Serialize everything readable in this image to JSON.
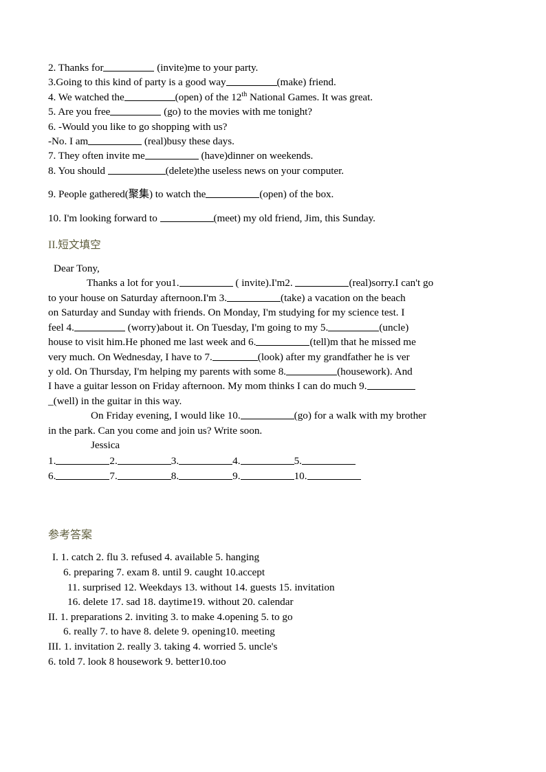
{
  "document": {
    "section_1": {
      "items": [
        {
          "id": "q2",
          "before": "2. Thanks for",
          "blank": true,
          "after": " (invite)me to your party."
        },
        {
          "id": "q3",
          "before": "3.Going to this kind of party is a good way",
          "blank": true,
          "after": "(make) friend."
        },
        {
          "id": "q4",
          "before": "4. We watched the",
          "blank": true,
          "after_pre": "(open) of the 12",
          "sup": "th",
          "after_post": " National Games. It was great."
        },
        {
          "id": "q5",
          "before": "5. Are you free",
          "blank": true,
          "after": " (go) to the movies with me tonight?"
        },
        {
          "id": "q6a",
          "before": "6. -Would you like to go shopping with us?",
          "blank": false,
          "after": ""
        },
        {
          "id": "q6b",
          "before": " -No. I am",
          "blank": true,
          "after": " (real)busy these days."
        },
        {
          "id": "q7",
          "before": "7. They often invite me",
          "blank": true,
          "after": " (have)dinner on weekends."
        },
        {
          "id": "q8",
          "before": "8. You should ",
          "blank": true,
          "after": "(delete)the useless news on your computer."
        },
        {
          "id": "q9",
          "before": "9. People gathered(聚集) to watch the",
          "blank": true,
          "after": "(open) of the box."
        },
        {
          "id": "q10",
          "before": "10. I'm looking forward to ",
          "blank": true,
          "after": "(meet) my old friend, Jim, this Sunday."
        }
      ]
    },
    "section_2": {
      "heading_roman": "II.",
      "heading_cn": "短文填空",
      "salutation": "Dear Tony,",
      "lines": [
        {
          "id": "p1",
          "segments": [
            {
              "t": "Thanks a lot for you1."
            },
            {
              "blank": "w78"
            },
            {
              "t": " ( invite).I'm2. "
            },
            {
              "blank": "w78"
            },
            {
              "t": "(real)sorry.I  can't go"
            }
          ]
        },
        {
          "id": "p2",
          "segments": [
            {
              "t": "to your house on Saturday afternoon.I'm 3."
            },
            {
              "blank": "w78"
            },
            {
              "t": "(take) a vacation on the beach"
            }
          ]
        },
        {
          "id": "p3",
          "segments": [
            {
              "t": "on Saturday and Sunday with friends. On Monday, I'm studying for my science test. I"
            }
          ]
        },
        {
          "id": "p4",
          "segments": [
            {
              "t": "feel 4."
            },
            {
              "blank": "w74"
            },
            {
              "t": " (worry)about it. On Tuesday, I'm going to my 5."
            },
            {
              "blank": "w74"
            },
            {
              "t": "(uncle)"
            }
          ]
        },
        {
          "id": "p5",
          "segments": [
            {
              "t": "house to visit him.He phoned me last week and 6."
            },
            {
              "blank": "w78"
            },
            {
              "t": "(tell)m that he missed me"
            }
          ]
        },
        {
          "id": "p6",
          "segments": [
            {
              "t": " very much. On Wednesday, I have to 7."
            },
            {
              "blank": "w66"
            },
            {
              "t": "(look) after my grandfather he is ver"
            }
          ]
        },
        {
          "id": "p7",
          "segments": [
            {
              "t": "y old. On Thursday, I'm helping my parents with some 8."
            },
            {
              "blank": "w74"
            },
            {
              "t": "(housework). And"
            }
          ]
        },
        {
          "id": "p8",
          "segments": [
            {
              "t": "I have a guitar lesson on Friday afternoon. My mom thinks I can do much 9."
            },
            {
              "blank": "w70"
            }
          ]
        },
        {
          "id": "p9",
          "segments": [
            {
              "t": "_(well) in the guitar in this way."
            }
          ]
        },
        {
          "id": "p10",
          "indent": "ind-3",
          "segments": [
            {
              "t": "On Friday evening, I would like 10."
            },
            {
              "blank": "w78"
            },
            {
              "t": "(go) for a walk with my brother"
            }
          ]
        },
        {
          "id": "p11",
          "segments": [
            {
              "t": "in the park. Can you come and join us? Write soon."
            }
          ]
        }
      ],
      "signature": "Jessica",
      "answer_rows": [
        [
          "1.",
          "2.",
          "3.",
          "4.",
          "5."
        ],
        [
          "6.",
          "7.",
          "8.",
          "9.",
          "10."
        ]
      ]
    },
    "answer_key": {
      "title": "参考答案",
      "lines": [
        {
          "id": "k1",
          "indent": "kind-1",
          "text": "I. 1. catch 2. flu 3. refused 4. available 5. hanging"
        },
        {
          "id": "k2",
          "indent": "kind-2",
          "text": "6.  preparing 7. exam 8. until 9. caught 10.accept"
        },
        {
          "id": "k3",
          "indent": "kind-3",
          "text": "11.    surprised 12. Weekdays 13. without 14. guests 15. invitation"
        },
        {
          "id": "k4",
          "indent": "kind-3",
          "text": "16.    delete 17. sad 18. daytime19. without 20. calendar"
        },
        {
          "id": "k5",
          "indent": "",
          "text": "II. 1. preparations 2. inviting 3. to make   4.opening 5. to go"
        },
        {
          "id": "k6",
          "indent": "kind-2",
          "text": "6. really 7. to have 8. delete 9. opening10. meeting"
        },
        {
          "id": "k7",
          "indent": "",
          "text": "III. 1. invitation 2. really 3. taking 4. worried 5. uncle's"
        },
        {
          "id": "k8",
          "indent": "",
          "text": "6. told 7. look 8 housework 9. better10.too"
        }
      ]
    },
    "colors": {
      "text": "#000000",
      "heading_accent": "#5d5c3b",
      "page_background": "#ffffff"
    }
  }
}
